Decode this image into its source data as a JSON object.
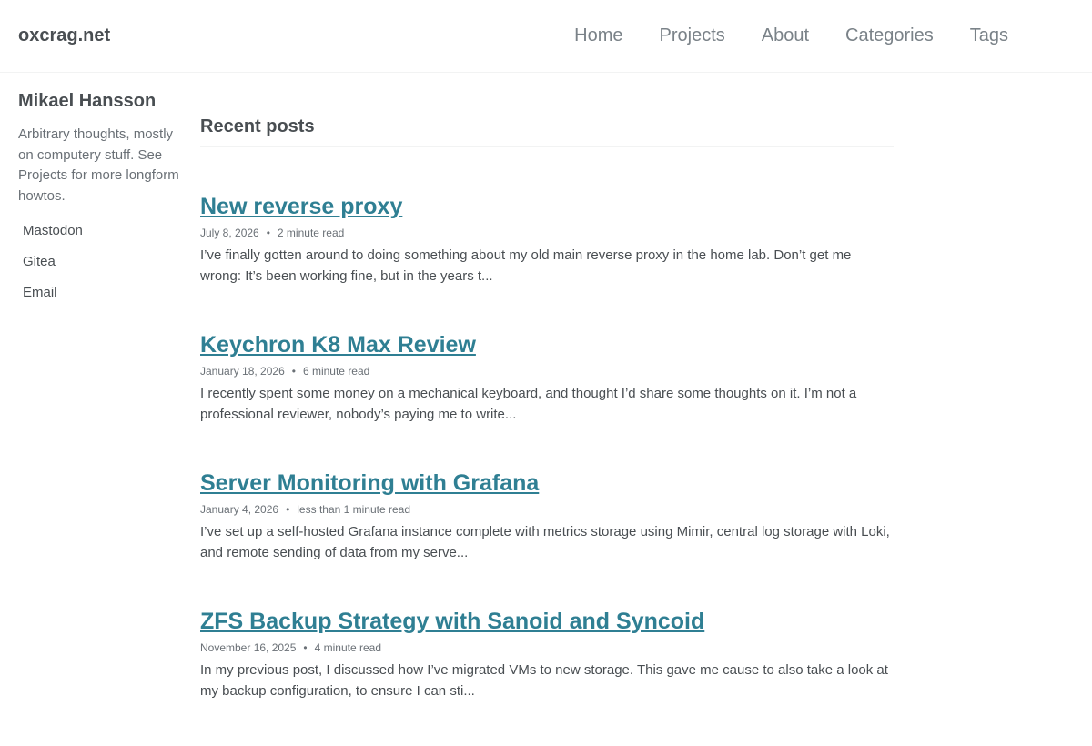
{
  "site": {
    "title": "oxcrag.net"
  },
  "nav": {
    "items": [
      {
        "label": "Home"
      },
      {
        "label": "Projects"
      },
      {
        "label": "About"
      },
      {
        "label": "Categories"
      },
      {
        "label": "Tags"
      }
    ]
  },
  "sidebar": {
    "author_name": "Mikael Hansson",
    "bio": "Arbitrary thoughts, mostly on computery stuff. See Projects for more longform howtos.",
    "links": [
      {
        "label": "Mastodon"
      },
      {
        "label": "Gitea"
      },
      {
        "label": "Email"
      }
    ]
  },
  "main": {
    "section_title": "Recent posts",
    "meta_separator": "•",
    "posts": [
      {
        "title": "New reverse proxy",
        "date": "July 8, 2026",
        "read_time": "2 minute read",
        "excerpt": "I’ve finally gotten around to doing something about my old main reverse proxy in the home lab. Don’t get me wrong: It’s been working fine, but in the years t..."
      },
      {
        "title": "Keychron K8 Max Review",
        "date": "January 18, 2026",
        "read_time": "6 minute read",
        "excerpt": "I recently spent some money on a mechanical keyboard, and thought I’d share some thoughts on it. I’m not a professional reviewer, nobody’s paying me to write..."
      },
      {
        "title": "Server Monitoring with Grafana",
        "date": "January 4, 2026",
        "read_time": "less than 1 minute read",
        "excerpt": "I’ve set up a self-hosted Grafana instance complete with metrics storage using Mimir, central log storage with Loki, and remote sending of data from my serve..."
      },
      {
        "title": "ZFS Backup Strategy with Sanoid and Syncoid",
        "date": "November 16, 2025",
        "read_time": "4 minute read",
        "excerpt": "In my previous post, I discussed how I’ve migrated VMs to new storage. This gave me cause to also take a look at my backup configuration, to ensure I can sti..."
      }
    ]
  }
}
